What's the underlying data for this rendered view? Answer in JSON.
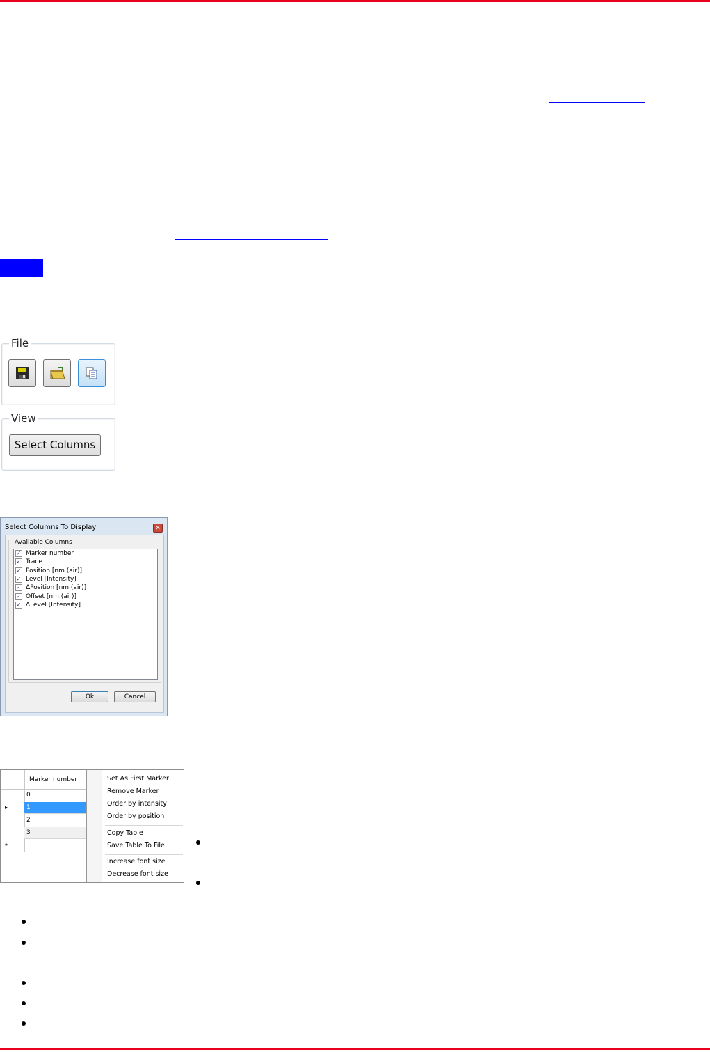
{
  "colors": {
    "rule": "#e8001c",
    "link": "#0000ff",
    "note": "#0000ff"
  },
  "file_group": {
    "label": "File",
    "buttons": [
      {
        "icon": "save-disk-icon"
      },
      {
        "icon": "open-folder-icon"
      },
      {
        "icon": "copy-icon"
      }
    ]
  },
  "view_group": {
    "label": "View",
    "select_columns_label": "Select Columns"
  },
  "dialog": {
    "title": "Select Columns To Display",
    "close_label": "✕",
    "fieldset_label": "Available Columns",
    "columns": [
      "Marker number",
      "Trace",
      "Position [nm (air)]",
      "Level [Intensity]",
      "ΔPosition [nm (air)]",
      "Offset [nm (air)]",
      "ΔLevel [Intensity]"
    ],
    "ok_label": "Ok",
    "cancel_label": "Cancel"
  },
  "grid": {
    "column_header": "Marker number",
    "rows": [
      "0",
      "1",
      "2",
      "3"
    ],
    "selected_index": 1,
    "new_row_marker": "*",
    "current_row_marker": "▸"
  },
  "context_menu": {
    "items": [
      "Set As First Marker",
      "Remove Marker",
      "Order by intensity",
      "Order by position",
      "Copy Table",
      "Save Table To File",
      "Increase font size",
      "Decrease font size"
    ]
  }
}
